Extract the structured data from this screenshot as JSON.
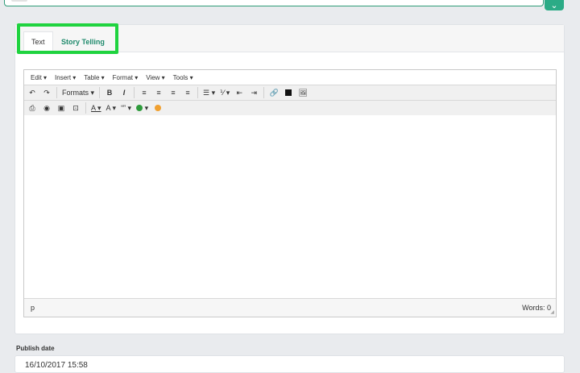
{
  "tabs": [
    {
      "label": "Text"
    },
    {
      "label": "Story Telling"
    }
  ],
  "editor": {
    "menus": [
      "Edit ▾",
      "Insert ▾",
      "Table ▾",
      "Format ▾",
      "View ▾",
      "Tools ▾"
    ],
    "toolbar1": {
      "undo": "↶",
      "redo": "↷",
      "formats": "Formats ▾",
      "bold": "B",
      "italic": "I",
      "align_left": "≡",
      "align_center": "≡",
      "align_right": "≡",
      "justify": "≡",
      "bullet_list": "☰ ▾",
      "numbered_list": "⅟ ▾",
      "outdent": "⇤",
      "indent": "⇥",
      "link": "🔗",
      "media": "▬",
      "image": "🖼"
    },
    "toolbar2": {
      "print": "⎙",
      "preview": "◉",
      "media2": "▣",
      "embed": "⊡",
      "text_color": "A ▾",
      "bg_color": "A ▾",
      "quote": "“” ▾",
      "emoji": "▾"
    },
    "status_path": "p",
    "word_count": "Words: 0"
  },
  "publish": {
    "label": "Publish date",
    "value": "16/10/2017 15:58"
  },
  "colors": {
    "accent": "#2bab86",
    "highlight": "#1fd33f",
    "tab_active_text": "#1f8a6c"
  }
}
